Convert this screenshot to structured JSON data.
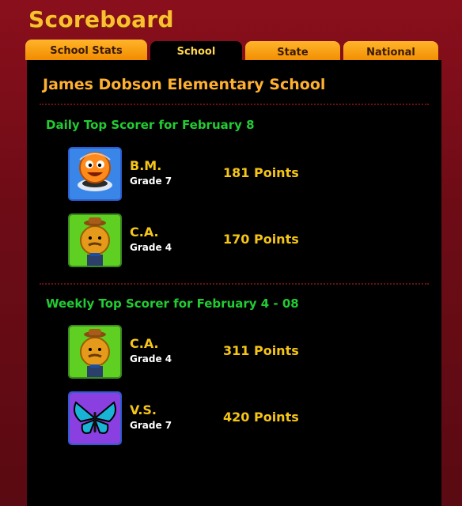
{
  "header": {
    "title": "Scoreboard"
  },
  "tabs": [
    {
      "label": "School Stats"
    },
    {
      "label": "School"
    },
    {
      "label": "State"
    },
    {
      "label": "National"
    }
  ],
  "school": {
    "name": "James Dobson Elementary School"
  },
  "daily": {
    "title": "Daily Top Scorer for February 8",
    "scorers": [
      {
        "initials": "B.M.",
        "grade": "Grade 7",
        "points": "181 Points",
        "avatar": "astronaut-avatar-icon"
      },
      {
        "initials": "C.A.",
        "grade": "Grade 4",
        "points": "170 Points",
        "avatar": "cowboy-avatar-icon"
      }
    ]
  },
  "weekly": {
    "title": "Weekly Top Scorer for February 4 - 08",
    "scorers": [
      {
        "initials": "C.A.",
        "grade": "Grade 4",
        "points": "311 Points",
        "avatar": "cowboy-avatar-icon"
      },
      {
        "initials": "V.S.",
        "grade": "Grade 7",
        "points": "420 Points",
        "avatar": "butterfly-avatar-icon"
      }
    ]
  },
  "colors": {
    "accent": "#f5c518",
    "section_title": "#22cc33",
    "frame": "#7a0d18",
    "tab": "#f7a21b"
  }
}
